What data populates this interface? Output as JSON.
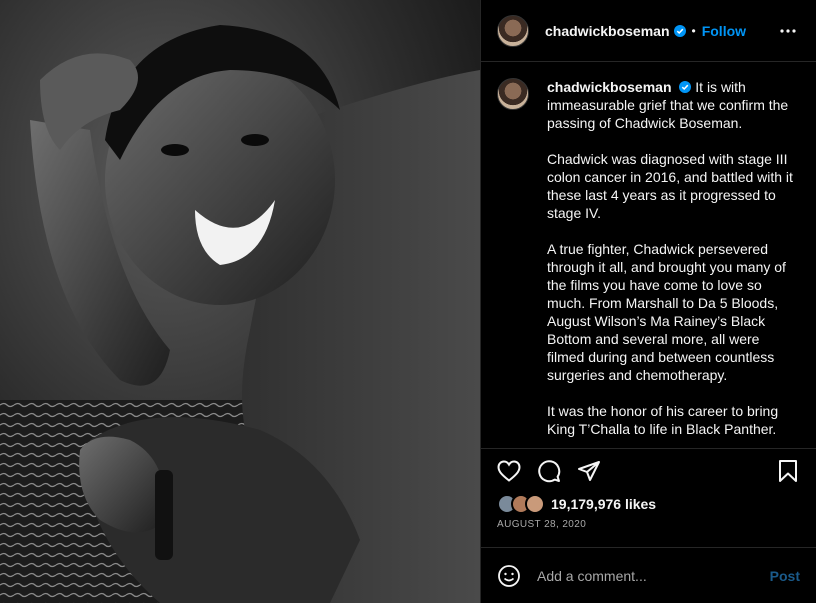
{
  "header": {
    "username": "chadwickboseman",
    "separator": "•",
    "follow_label": "Follow"
  },
  "caption": {
    "username": "chadwickboseman",
    "paragraphs": [
      "It is with immeasurable grief that we confirm the passing of Chadwick Boseman.",
      "Chadwick was diagnosed with stage III colon cancer in 2016, and battled with it these last 4 years as it progressed to stage IV.",
      "A true fighter, Chadwick persevered through it all, and brought you many of the films you have come to love so much. From Marshall to Da 5 Bloods, August Wilson’s Ma Rainey’s Black Bottom and several more, all were filmed during and between countless surgeries and chemotherapy.",
      "It was the honor of his career to bring King T’Challa to life in Black Panther."
    ]
  },
  "actions": {
    "icons": [
      "heart-icon",
      "comment-icon",
      "share-icon",
      "bookmark-icon"
    ]
  },
  "likes": {
    "count_text": "19,179,976 likes"
  },
  "date": "AUGUST 28, 2020",
  "comment_box": {
    "placeholder": "Add a comment...",
    "post_label": "Post"
  },
  "colors": {
    "accent": "#0095f6",
    "background": "#000000",
    "border": "#262626",
    "muted_text": "#a8a8a8"
  }
}
